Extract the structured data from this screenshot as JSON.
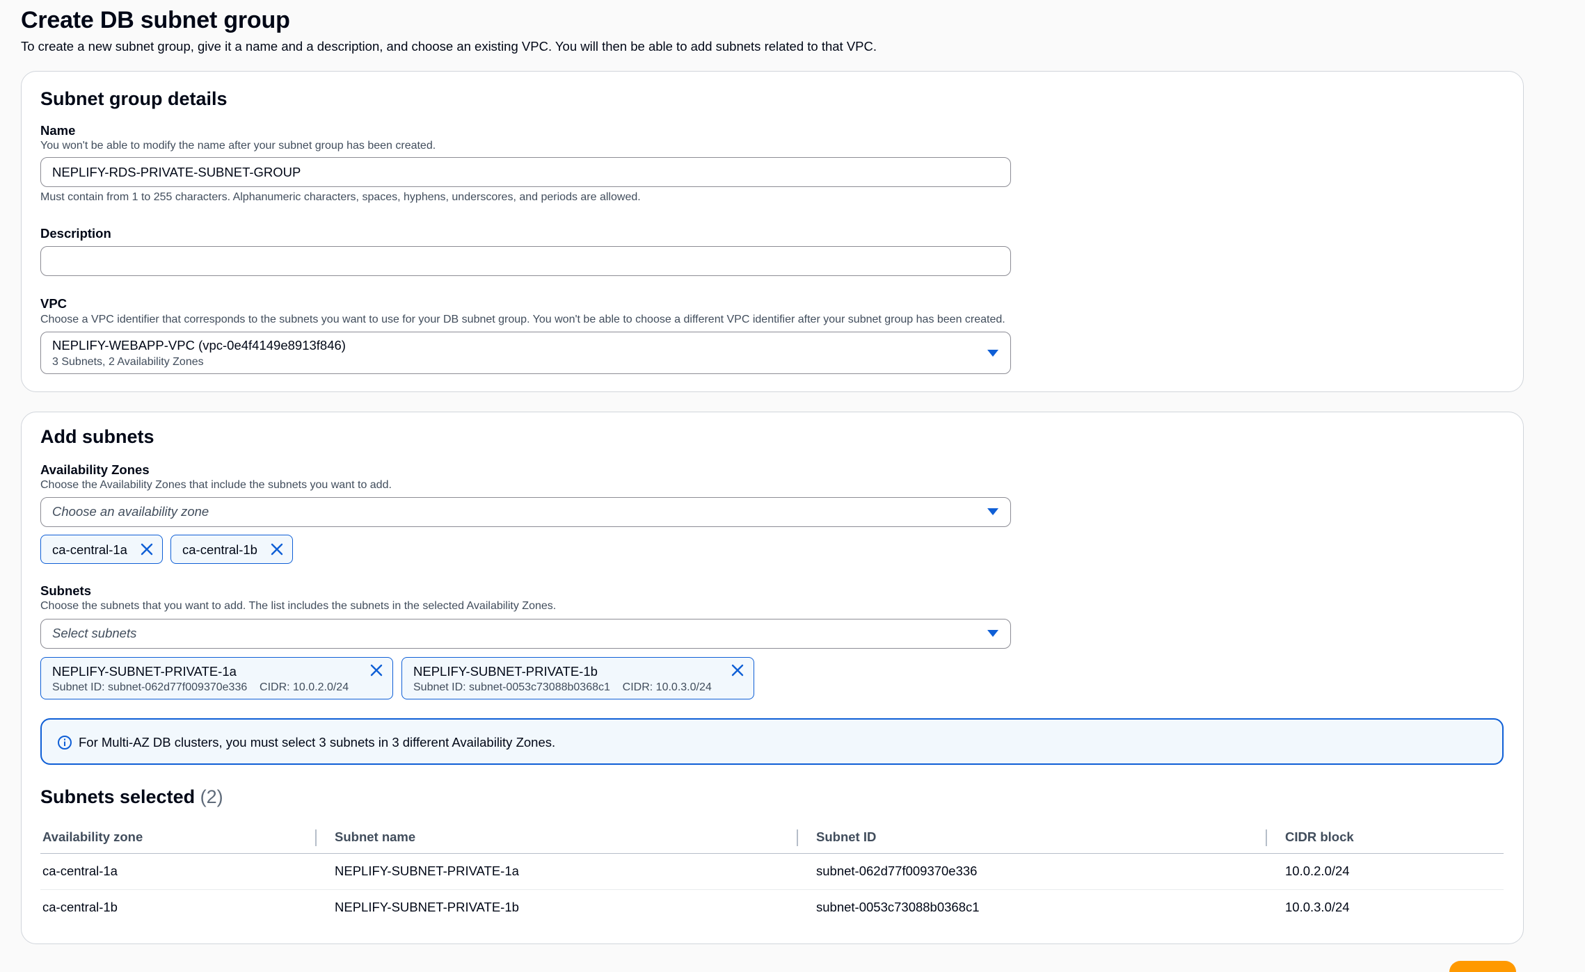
{
  "page": {
    "title": "Create DB subnet group",
    "description": "To create a new subnet group, give it a name and a description, and choose an existing VPC. You will then be able to add subnets related to that VPC."
  },
  "details": {
    "heading": "Subnet group details",
    "name_label": "Name",
    "name_hint": "You won't be able to modify the name after your subnet group has been created.",
    "name_value": "NEPLIFY-RDS-PRIVATE-SUBNET-GROUP",
    "name_constraint": "Must contain from 1 to 255 characters. Alphanumeric characters, spaces, hyphens, underscores, and periods are allowed.",
    "description_label": "Description",
    "description_value": "",
    "vpc_label": "VPC",
    "vpc_hint": "Choose a VPC identifier that corresponds to the subnets you want to use for your DB subnet group. You won't be able to choose a different VPC identifier after your subnet group has been created.",
    "vpc_selected": "NEPLIFY-WEBAPP-VPC (vpc-0e4f4149e8913f846)",
    "vpc_selected_sub": "3 Subnets, 2 Availability Zones"
  },
  "subnets_panel": {
    "heading": "Add subnets",
    "az_label": "Availability Zones",
    "az_hint": "Choose the Availability Zones that include the subnets you want to add.",
    "az_placeholder": "Choose an availability zone",
    "az_tokens": [
      "ca-central-1a",
      "ca-central-1b"
    ],
    "subnets_label": "Subnets",
    "subnets_hint": "Choose the subnets that you want to add. The list includes the subnets in the selected Availability Zones.",
    "subnets_placeholder": "Select subnets",
    "subnet_tokens": [
      {
        "name": "NEPLIFY-SUBNET-PRIVATE-1a",
        "detail": "Subnet ID: subnet-062d77f009370e336    CIDR: 10.0.2.0/24"
      },
      {
        "name": "NEPLIFY-SUBNET-PRIVATE-1b",
        "detail": "Subnet ID: subnet-0053c73088b0368c1    CIDR: 10.0.3.0/24"
      }
    ],
    "alert_text": "For Multi-AZ DB clusters, you must select 3 subnets in 3 different Availability Zones."
  },
  "selected": {
    "heading": "Subnets selected",
    "count": "(2)",
    "columns": [
      "Availability zone",
      "Subnet name",
      "Subnet ID",
      "CIDR block"
    ],
    "rows": [
      [
        "ca-central-1a",
        "NEPLIFY-SUBNET-PRIVATE-1a",
        "subnet-062d77f009370e336",
        "10.0.2.0/24"
      ],
      [
        "ca-central-1b",
        "NEPLIFY-SUBNET-PRIVATE-1b",
        "subnet-0053c73088b0368c1",
        "10.0.3.0/24"
      ]
    ]
  },
  "colors": {
    "accent": "#0f5fd6",
    "info_bg": "#f2f8fd",
    "primary_button": "#ff9900"
  }
}
